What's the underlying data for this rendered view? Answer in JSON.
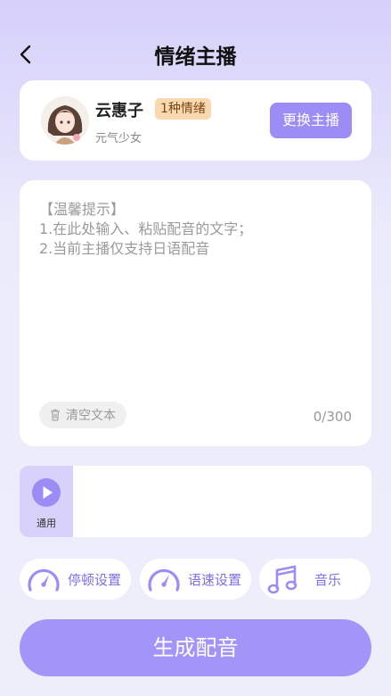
{
  "header": {
    "title": "情绪主播",
    "back_icon": "chevron-left-icon"
  },
  "anchor": {
    "name": "云惠子",
    "emotion_badge": "1种情绪",
    "subtitle": "元气少女",
    "change_button": "更换主播"
  },
  "editor": {
    "placeholder": "【温馨提示】\n1.在此处输入、粘贴配音的文字；\n2.当前主播仅支持日语配音",
    "value": "",
    "clear_label": "清空文本",
    "char_count": "0/300"
  },
  "styles": [
    {
      "label": "通用",
      "selected": true
    }
  ],
  "settings": {
    "pause": "停顿设置",
    "speed": "语速设置",
    "music": "音乐"
  },
  "generate_button": "生成配音",
  "colors": {
    "accent": "#9b8cf6",
    "badge_bg": "#fbd9b0",
    "badge_text": "#7a4712"
  }
}
